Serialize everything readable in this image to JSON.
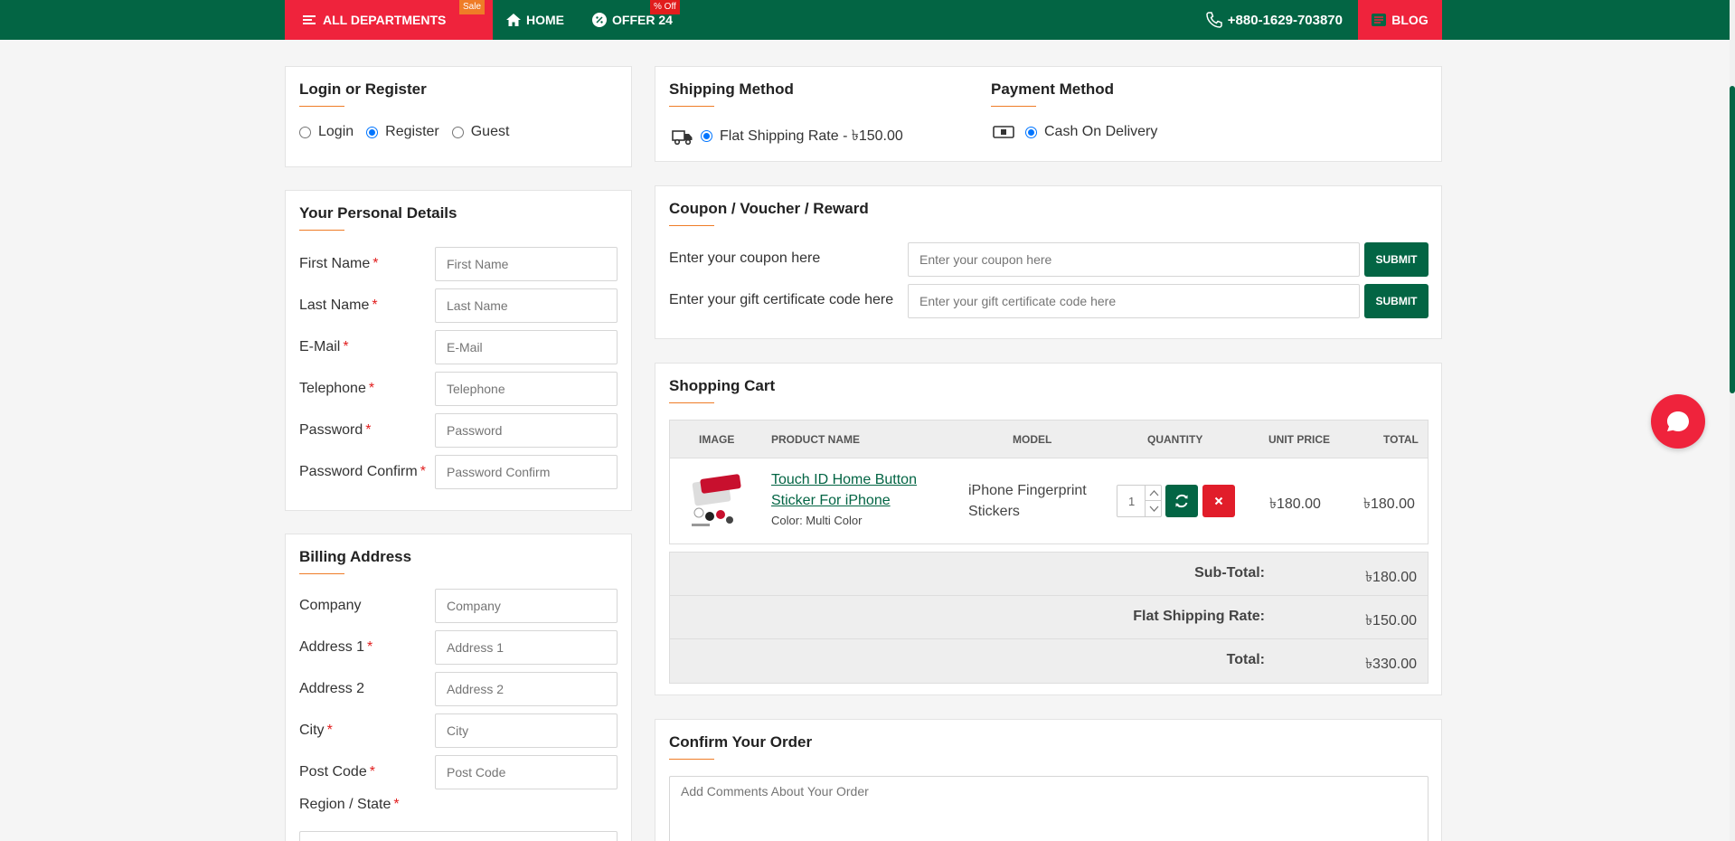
{
  "nav": {
    "departments": "ALL DEPARTMENTS",
    "departments_badge": "Sale",
    "home": "HOME",
    "offer": "OFFER 24",
    "offer_badge": "% Off",
    "phone": "+880-1629-703870",
    "blog": "BLOG"
  },
  "login": {
    "title": "Login or Register",
    "options": [
      "Login",
      "Register",
      "Guest"
    ],
    "selected": "Register"
  },
  "personal": {
    "title": "Your Personal Details",
    "fields": [
      {
        "label": "First Name",
        "placeholder": "First Name"
      },
      {
        "label": "Last Name",
        "placeholder": "Last Name"
      },
      {
        "label": "E-Mail",
        "placeholder": "E-Mail"
      },
      {
        "label": "Telephone",
        "placeholder": "Telephone"
      },
      {
        "label": "Password",
        "placeholder": "Password"
      },
      {
        "label": "Password Confirm",
        "placeholder": "Password Confirm"
      }
    ]
  },
  "billing": {
    "title": "Billing Address",
    "fields": [
      {
        "label": "Company",
        "placeholder": "Company"
      },
      {
        "label": "Address 1",
        "placeholder": "Address 1"
      },
      {
        "label": "Address 2",
        "placeholder": "Address 2"
      },
      {
        "label": "City",
        "placeholder": "City"
      },
      {
        "label": "Post Code",
        "placeholder": "Post Code"
      },
      {
        "label": "Region / State"
      }
    ]
  },
  "shipping": {
    "title": "Shipping Method",
    "option": "Flat Shipping Rate - ৳150.00"
  },
  "payment": {
    "title": "Payment Method",
    "option": "Cash On Delivery"
  },
  "coupon": {
    "title": "Coupon / Voucher / Reward",
    "coupon_label": "Enter your coupon here",
    "coupon_placeholder": "Enter your coupon here",
    "gift_label": "Enter your gift certificate code here",
    "gift_placeholder": "Enter your gift certificate code here",
    "submit": "SUBMIT"
  },
  "cart": {
    "title": "Shopping Cart",
    "headers": [
      "IMAGE",
      "PRODUCT NAME",
      "MODEL",
      "QUANTITY",
      "UNIT PRICE",
      "TOTAL"
    ],
    "item": {
      "name_line1": "Touch ID Home Button",
      "name_line2": "Sticker For iPhone",
      "option": "Color: Multi Color",
      "model_line1": "iPhone Fingerprint",
      "model_line2": "Stickers",
      "quantity": "1",
      "unit_price": "৳180.00",
      "total": "৳180.00"
    },
    "totals": [
      {
        "label": "Sub-Total:",
        "value": "৳180.00"
      },
      {
        "label": "Flat Shipping Rate:",
        "value": "৳150.00"
      },
      {
        "label": "Total:",
        "value": "৳330.00"
      }
    ]
  },
  "confirm": {
    "title": "Confirm Your Order",
    "comment_placeholder": "Add Comments About Your Order"
  },
  "colors": {
    "brand_green": "#036544",
    "accent_red": "#ef233c",
    "accent_orange": "#ef7c27"
  }
}
